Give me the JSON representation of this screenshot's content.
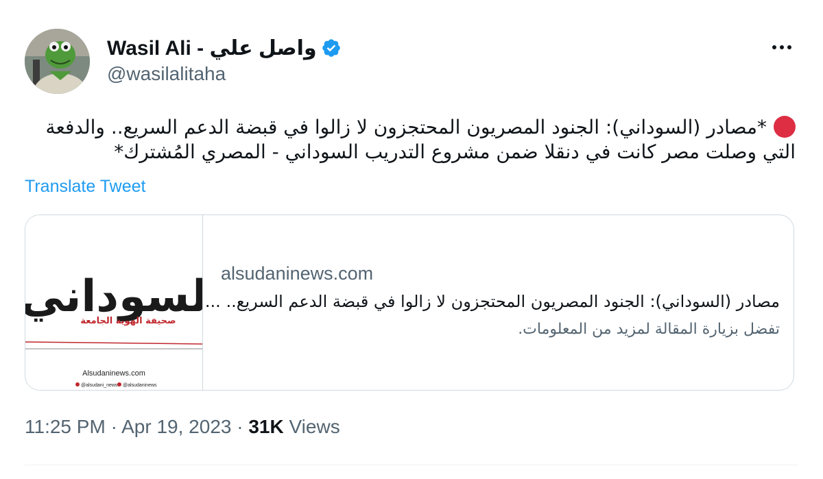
{
  "author": {
    "display_name": "Wasil Ali - واصل علي",
    "handle": "@wasilalitaha",
    "verified_icon": "verified-badge-icon",
    "verified_color": "#1d9bf0"
  },
  "more_icon": "more-dots-icon",
  "tweet": {
    "text": "*مصادر (السوداني): الجنود المصريون المحتجزون لا زالوا في قبضة الدعم السريع.. والدفعة التي وصلت مصر كانت في دنقلا ضمن مشروع التدريب السوداني - المصري المُشترك*",
    "emoji": "red-circle"
  },
  "translate_label": "Translate Tweet",
  "card": {
    "logo_text": "لسوداني",
    "logo_sub": "صحيفة الهوية الجامعة",
    "logo_site": "Alsudaninews.com",
    "logo_social_1": "@alsudani_news",
    "logo_social_2": "@alsudaninews",
    "domain": "alsudaninews.com",
    "title": "مصادر (السوداني): الجنود المصريون المحتجزون لا زالوا في قبضة الدعم السريع.. ...",
    "description": "تفضل بزيارة المقالة لمزيد من المعلومات."
  },
  "meta": {
    "time": "11:25 PM",
    "separator": "·",
    "date": "Apr 19, 2023",
    "views_count": "31K",
    "views_label": "Views"
  },
  "colors": {
    "accent": "#1d9bf0",
    "text": "#0f1419",
    "muted": "#536471",
    "red_dot": "#dd2e44",
    "logo_red": "#c0272d"
  }
}
